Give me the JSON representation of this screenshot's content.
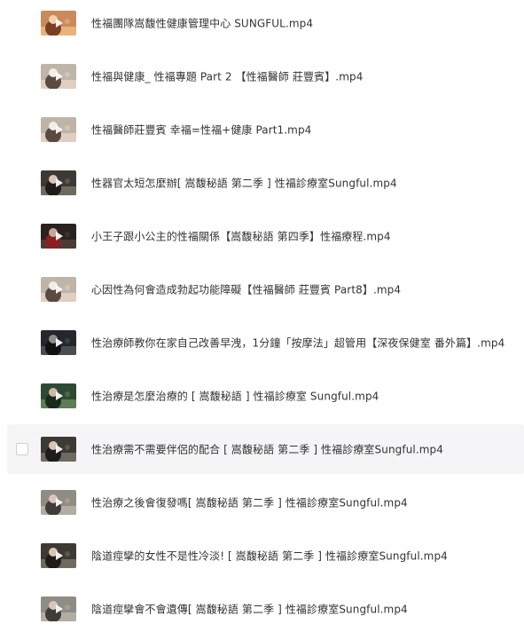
{
  "files": [
    {
      "name": "性福團隊嵩馥性健康管理中心 SUNGFUL.mp4",
      "thumb": "warm",
      "hovered": false
    },
    {
      "name": "性福與健康_ 性福專題 Part 2 【性福醫師 莊豐賓】.mp4",
      "thumb": "doctor",
      "hovered": false
    },
    {
      "name": "性福醫師莊豐賓 幸福=性福+健康 Part1.mp4",
      "thumb": "doctor",
      "hovered": false
    },
    {
      "name": "性器官太短怎麼辦[ 嵩馥秘語 第二季 ] 性福診療室Sungful.mp4",
      "thumb": "woman-dark",
      "hovered": false
    },
    {
      "name": "小王子跟小公主的性福關係【嵩馥秘語 第四季】性福療程.mp4",
      "thumb": "woman-red",
      "hovered": false
    },
    {
      "name": "心因性為何會造成勃起功能障礙【性福醫師 莊豐賓 Part8】.mp4",
      "thumb": "doctor",
      "hovered": false
    },
    {
      "name": "性治療師教你在家自己改善早洩，1分鐘「按摩法」超管用【深夜保健室 番外篇】.mp4",
      "thumb": "night",
      "hovered": false
    },
    {
      "name": "性治療是怎麼治療的 [ 嵩馥秘語 ] 性福診療室 Sungful.mp4",
      "thumb": "woman-green",
      "hovered": false
    },
    {
      "name": "性治療需不需要伴侶的配合 [ 嵩馥秘語 第二季 ] 性福診療室Sungful.mp4",
      "thumb": "woman-dark",
      "hovered": true
    },
    {
      "name": "性治療之後會復發嗎[ 嵩馥秘語 第二季 ] 性福診療室Sungful.mp4",
      "thumb": "woman-gray",
      "hovered": false
    },
    {
      "name": "陰道痙攣的女性不是性冷淡! [ 嵩馥秘語 第二季 ] 性福診療室Sungful.mp4",
      "thumb": "woman-dark",
      "hovered": false
    },
    {
      "name": "陰道痙攣會不會遺傳[ 嵩馥秘語 第二季 ] 性福診療室Sungful.mp4",
      "thumb": "woman-gray",
      "hovered": false
    }
  ]
}
